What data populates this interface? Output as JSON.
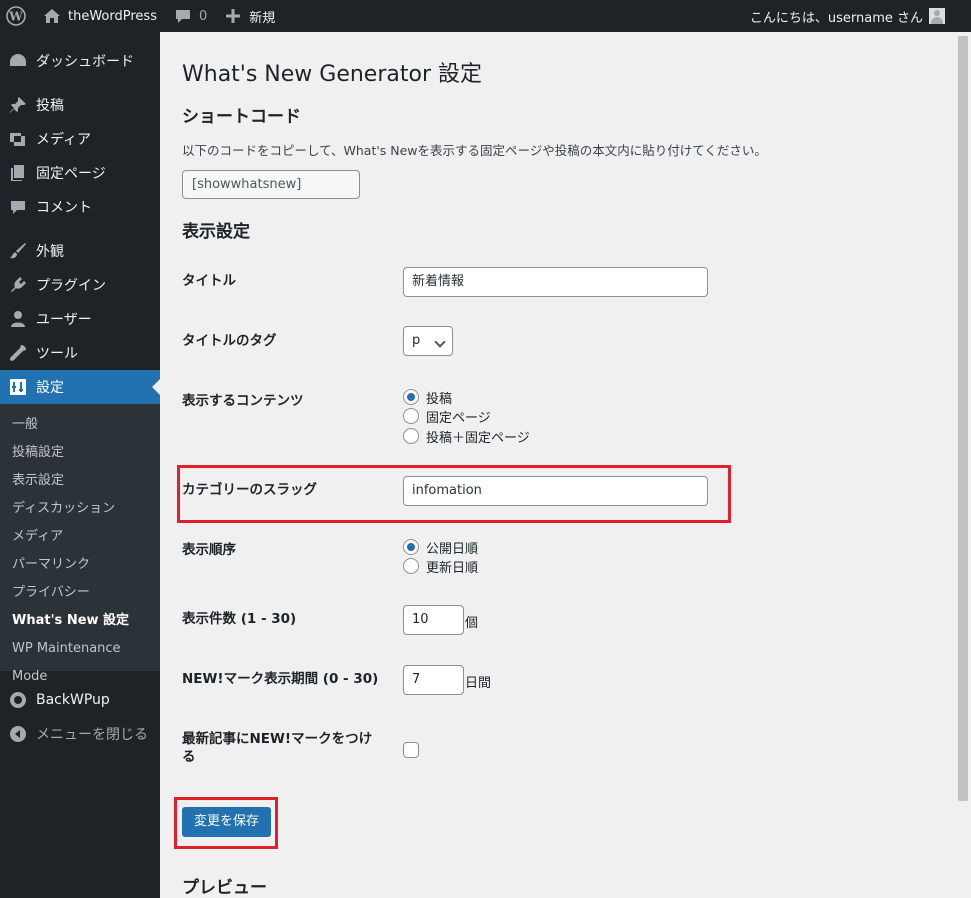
{
  "adminbar": {
    "site_name": "theWordPress",
    "comments_count": "0",
    "new_label": "新規",
    "greeting": "こんにちは、username さん"
  },
  "sidebar": {
    "items": [
      {
        "label": "ダッシュボード",
        "icon": "dashboard-icon"
      },
      {
        "label": "投稿",
        "icon": "pin-icon"
      },
      {
        "label": "メディア",
        "icon": "media-icon"
      },
      {
        "label": "固定ページ",
        "icon": "page-icon"
      },
      {
        "label": "コメント",
        "icon": "comment-icon"
      },
      {
        "label": "外観",
        "icon": "brush-icon"
      },
      {
        "label": "プラグイン",
        "icon": "plugin-icon"
      },
      {
        "label": "ユーザー",
        "icon": "user-icon"
      },
      {
        "label": "ツール",
        "icon": "wrench-icon"
      },
      {
        "label": "設定",
        "icon": "settings-icon"
      }
    ],
    "submenu": [
      "一般",
      "投稿設定",
      "表示設定",
      "ディスカッション",
      "メディア",
      "パーマリンク",
      "プライバシー",
      "What's New 設定",
      "WP Maintenance Mode"
    ],
    "backwpup": "BackWPup",
    "collapse": "メニューを閉じる"
  },
  "main": {
    "page_title": "What's New Generator 設定",
    "shortcode_heading": "ショートコード",
    "shortcode_desc": "以下のコードをコピーして、What's Newを表示する固定ページや投稿の本文内に貼り付けてください。",
    "shortcode_value": "[showwhatsnew]",
    "display_heading": "表示設定",
    "title_label": "タイトル",
    "title_value": "新着情報",
    "tag_label": "タイトルのタグ",
    "tag_value": "p",
    "content_label": "表示するコンテンツ",
    "content_options": [
      "投稿",
      "固定ページ",
      "投稿＋固定ページ"
    ],
    "category_label": "カテゴリーのスラッグ",
    "category_value": "infomation",
    "order_label": "表示順序",
    "order_options": [
      "公開日順",
      "更新日順"
    ],
    "count_label": "表示件数 (1 - 30)",
    "count_value": "10",
    "count_suffix": "個",
    "newmark_label": "NEW!マーク表示期間 (0 - 30)",
    "newmark_value": "7",
    "newmark_suffix": "日間",
    "latest_label": "最新記事にNEW!マークをつけ",
    "latest_label_2": "る",
    "save_button": "変更を保存",
    "preview_heading": "プレビュー"
  },
  "colors": {
    "accent": "#2271b1",
    "highlight": "#e0202e",
    "sidebar_bg": "#1d2327"
  }
}
